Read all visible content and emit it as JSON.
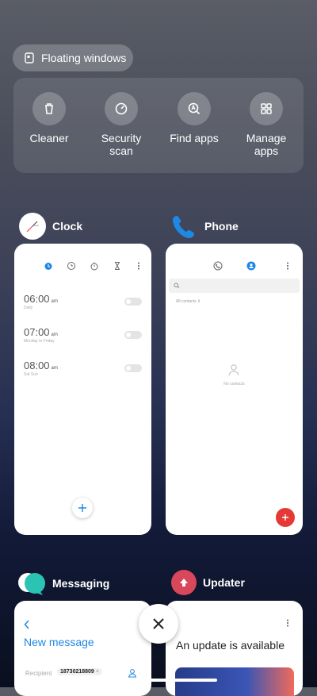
{
  "floating_windows": {
    "label": "Floating windows",
    "icon": "floating-window-icon"
  },
  "tools": [
    {
      "label": "Cleaner",
      "icon": "trash-icon"
    },
    {
      "label": "Security\nscan",
      "icon": "shield-scan-icon"
    },
    {
      "label": "Find apps",
      "icon": "find-apps-icon"
    },
    {
      "label": "Manage\napps",
      "icon": "grid-icon"
    }
  ],
  "cards": {
    "clock": {
      "title": "Clock",
      "alarms": [
        {
          "time": "06:00",
          "ampm": "am",
          "repeat": "Daily"
        },
        {
          "time": "07:00",
          "ampm": "am",
          "repeat": "Monday to Friday"
        },
        {
          "time": "08:00",
          "ampm": "am",
          "repeat": "Sat Sun"
        }
      ]
    },
    "phone": {
      "title": "Phone",
      "filter": "All contacts",
      "empty": "No contacts"
    },
    "messaging": {
      "title": "Messaging",
      "header": "New message",
      "recipient_label": "Recipient",
      "recipient_value": "18730218809"
    },
    "updater": {
      "title": "Updater",
      "message": "An update is available"
    }
  },
  "colors": {
    "accent_blue": "#1e88e5",
    "fab_red": "#e53935",
    "updater_red": "#d9475a"
  }
}
